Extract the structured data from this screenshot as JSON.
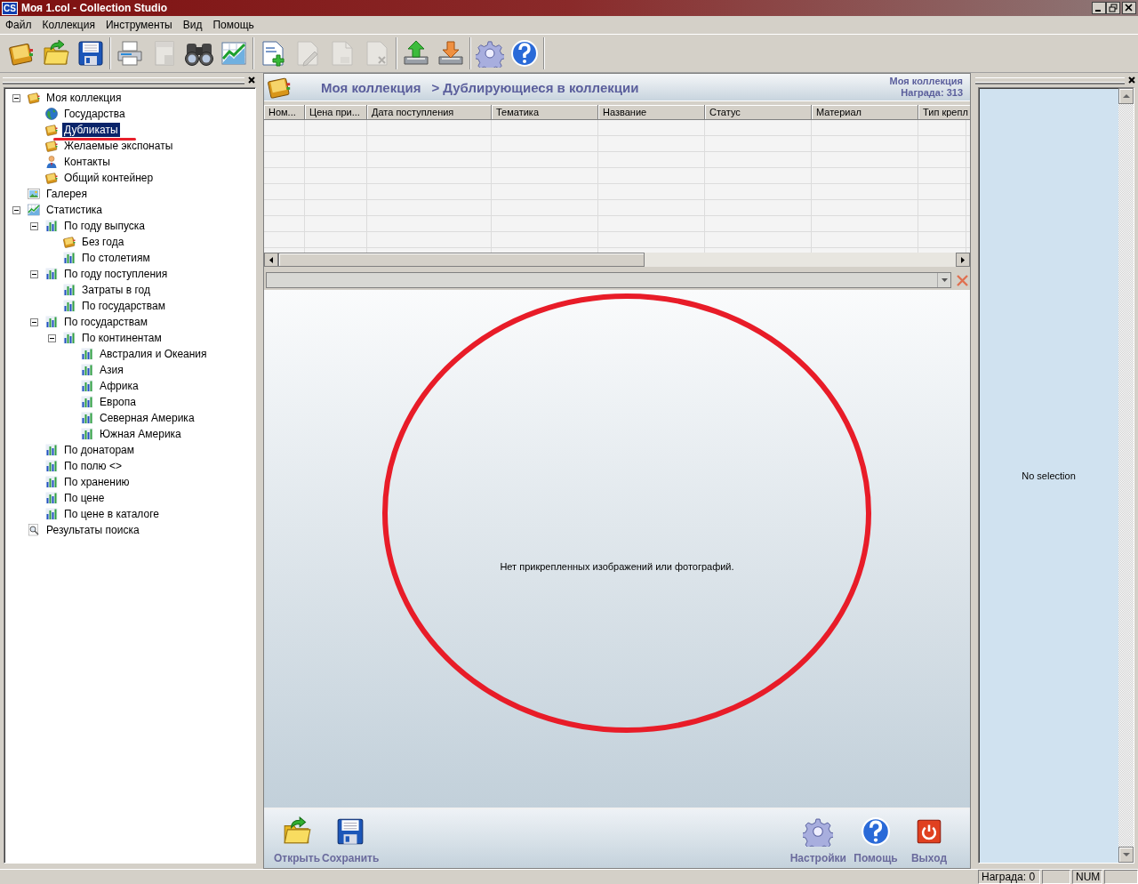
{
  "window": {
    "title": "Моя 1.col - Collection Studio",
    "app_badge": "CS"
  },
  "menu": [
    "Файл",
    "Коллекция",
    "Инструменты",
    "Вид",
    "Помощь"
  ],
  "toolbar_groups": [
    [
      {
        "kind": "book",
        "disabled": false
      },
      {
        "kind": "open",
        "disabled": false
      },
      {
        "kind": "save",
        "disabled": false
      }
    ],
    [
      {
        "kind": "print",
        "disabled": false
      },
      {
        "kind": "preview",
        "disabled": true
      },
      {
        "kind": "binoculars",
        "disabled": false
      },
      {
        "kind": "stats",
        "disabled": false
      }
    ],
    [
      {
        "kind": "new-doc",
        "disabled": false
      },
      {
        "kind": "edit-doc",
        "disabled": true
      },
      {
        "kind": "copy-doc",
        "disabled": true
      },
      {
        "kind": "delete-doc",
        "disabled": true
      }
    ],
    [
      {
        "kind": "import",
        "disabled": false
      },
      {
        "kind": "export",
        "disabled": false
      }
    ],
    [
      {
        "kind": "gear",
        "disabled": false
      },
      {
        "kind": "help",
        "disabled": false
      }
    ]
  ],
  "tree": [
    {
      "label": "Моя коллекция",
      "kind": "book",
      "selected": false,
      "expanded": true,
      "children": [
        {
          "label": "Государства",
          "kind": "globe",
          "selected": false
        },
        {
          "label": "Дубликаты",
          "kind": "book",
          "selected": true
        },
        {
          "label": "Желаемые экспонаты",
          "kind": "book",
          "selected": false
        },
        {
          "label": "Контакты",
          "kind": "person",
          "selected": false
        },
        {
          "label": "Общий контейнер",
          "kind": "book",
          "selected": false
        }
      ]
    },
    {
      "label": "Галерея",
      "kind": "gallery",
      "selected": false
    },
    {
      "label": "Статистика",
      "kind": "stats",
      "selected": false,
      "expanded": true,
      "children": [
        {
          "label": "По году выпуска",
          "kind": "chart",
          "selected": false,
          "expanded": true,
          "children": [
            {
              "label": "Без года",
              "kind": "book",
              "selected": false
            },
            {
              "label": "По столетиям",
              "kind": "chart",
              "selected": false
            }
          ]
        },
        {
          "label": "По году поступления",
          "kind": "chart",
          "selected": false,
          "expanded": true,
          "children": [
            {
              "label": "Затраты в год",
              "kind": "chart",
              "selected": false
            },
            {
              "label": "По государствам",
              "kind": "chart",
              "selected": false
            }
          ]
        },
        {
          "label": "По государствам",
          "kind": "chart",
          "selected": false,
          "expanded": true,
          "children": [
            {
              "label": "По континентам",
              "kind": "chart",
              "selected": false,
              "expanded": true,
              "children": [
                {
                  "label": "Австралия и Океания",
                  "kind": "chart",
                  "selected": false
                },
                {
                  "label": "Азия",
                  "kind": "chart",
                  "selected": false
                },
                {
                  "label": "Африка",
                  "kind": "chart",
                  "selected": false
                },
                {
                  "label": "Европа",
                  "kind": "chart",
                  "selected": false
                },
                {
                  "label": "Северная Америка",
                  "kind": "chart",
                  "selected": false
                },
                {
                  "label": "Южная Америка",
                  "kind": "chart",
                  "selected": false
                }
              ]
            }
          ]
        },
        {
          "label": "По донаторам",
          "kind": "chart",
          "selected": false
        },
        {
          "label": "По полю <>",
          "kind": "chart",
          "selected": false
        },
        {
          "label": "По хранению",
          "kind": "chart",
          "selected": false
        },
        {
          "label": "По цене",
          "kind": "chart",
          "selected": false
        },
        {
          "label": "По цене в каталоге",
          "kind": "chart",
          "selected": false
        }
      ]
    },
    {
      "label": "Результаты поиска",
      "kind": "search",
      "selected": false
    }
  ],
  "center": {
    "breadcrumb_root": "Моя коллекция",
    "breadcrumb_page": "> Дублирующиеся в коллекции",
    "collection_name": "Моя коллекция",
    "award": "Награда: 313",
    "table": {
      "columns": [
        "Ном...",
        "Цена при...",
        "Дата поступления",
        "Тематика",
        "Название",
        "Статус",
        "Материал",
        "Тип крепл"
      ]
    },
    "image_message": "Нет прикрепленных изображений или фотографий.",
    "actions_left": [
      {
        "label": "Открыть",
        "kind": "open"
      },
      {
        "label": "Сохранить",
        "kind": "save"
      }
    ],
    "actions_right": [
      {
        "label": "Настройки",
        "kind": "gear"
      },
      {
        "label": "Помощь",
        "kind": "help"
      },
      {
        "label": "Выход",
        "kind": "exit"
      }
    ]
  },
  "right_panel": {
    "message": "No selection"
  },
  "status_bar": {
    "award": "Награда: 0",
    "num_lock": "NUM"
  }
}
